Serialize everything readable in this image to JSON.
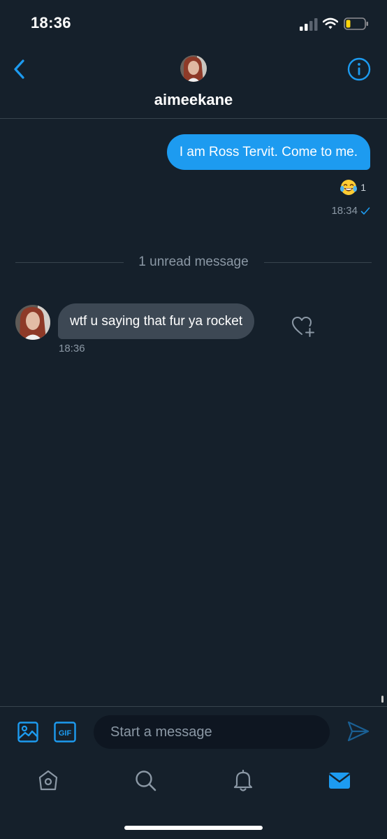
{
  "status_bar": {
    "time": "18:36"
  },
  "header": {
    "username": "aimeekane"
  },
  "messages": [
    {
      "direction": "outgoing",
      "text": "I am Ross Tervit. Come to me.",
      "reaction_emoji": "face-with-tears-of-joy",
      "reaction_count": "1",
      "time": "18:34",
      "status": "sent-checkmark"
    },
    {
      "direction": "incoming",
      "text": "wtf u saying that fur ya rocket",
      "time": "18:36"
    }
  ],
  "divider": {
    "text": "1 unread message"
  },
  "composer": {
    "placeholder": "Start a message",
    "gif_label": "GIF"
  },
  "tabs": [
    "home-icon",
    "search-icon",
    "notifications-bell-icon",
    "messages-mail-icon"
  ],
  "colors": {
    "background": "#15202b",
    "accent": "#1d9bf0",
    "incoming_bubble": "#3d4854",
    "muted_text": "#8b98a5"
  }
}
